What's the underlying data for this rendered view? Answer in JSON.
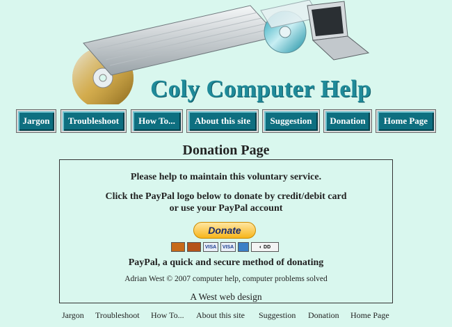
{
  "site": {
    "title": "Coly Computer Help"
  },
  "nav": [
    "Jargon",
    "Troubleshoot",
    "How To...",
    "About this site",
    "Suggestion",
    "Donation",
    "Home Page"
  ],
  "page": {
    "heading": "Donation Page"
  },
  "content": {
    "line1": "Please help to maintain this voluntary service.",
    "line2": "Click the PayPal logo below to donate by credit/debit card",
    "line3": "or use your PayPal account",
    "donate_label": "Donate",
    "card_icons": [
      "mastercard-icon",
      "maestro-icon",
      "visa-icon",
      "visa-electron-icon",
      "amex-icon",
      "direct-debit-icon"
    ],
    "paypal_text": "PayPal, a quick and secure method of donating",
    "copyright": "Adrian West © 2007 computer help, computer problems solved",
    "design": "A West web design"
  },
  "footer_nav": [
    "Jargon",
    "Troubleshoot",
    "How To...",
    "About this site",
    "Suggestion",
    "Donation",
    "Home Page"
  ],
  "colors": {
    "background": "#d9f7ee",
    "title": "#1f8a99",
    "nav_button": "#0e6f80",
    "donate": "#f7b51b"
  }
}
